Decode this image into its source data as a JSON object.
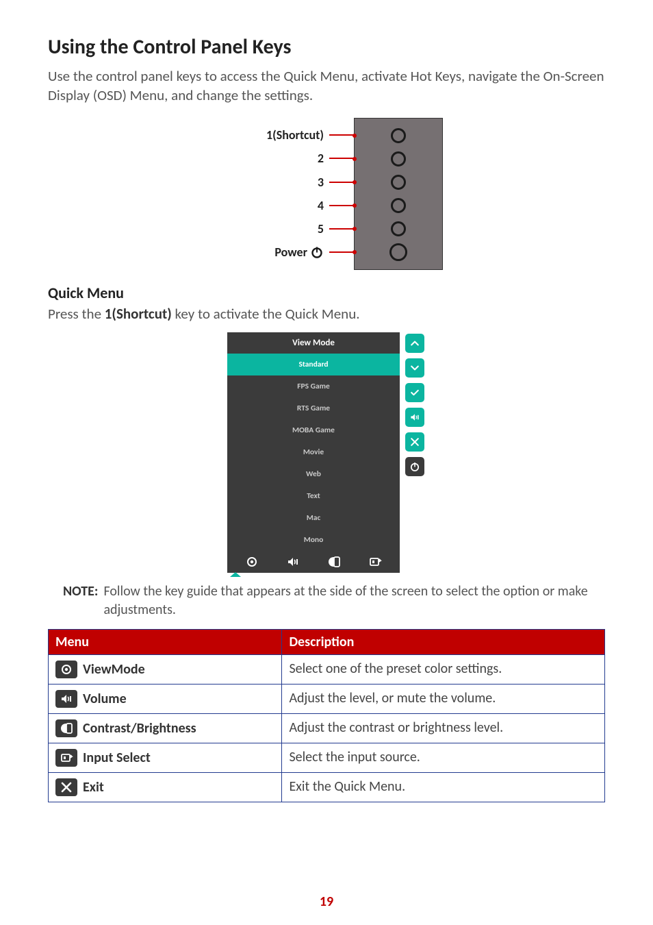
{
  "heading": "Using the Control Panel Keys",
  "intro": "Use the control panel keys to access the Quick Menu, activate Hot Keys, navigate the On-Screen Display (OSD) Menu, and change the settings.",
  "panel_labels": [
    "1(Shortcut)",
    "2",
    "3",
    "4",
    "5",
    "Power"
  ],
  "quick_menu_heading": "Quick Menu",
  "quick_menu_text_pre": "Press the ",
  "quick_menu_text_bold": "1(Shortcut)",
  "quick_menu_text_post": " key to activate the Quick Menu.",
  "osd": {
    "header": "View Mode",
    "items": [
      "Standard",
      "FPS Game",
      "RTS Game",
      "MOBA Game",
      "Movie",
      "Web",
      "Text",
      "Mac",
      "Mono"
    ],
    "selected_index": 0,
    "footer_icons": [
      "eye-icon",
      "volume-icon",
      "contrast-icon",
      "input-icon"
    ],
    "side_buttons": [
      "up-icon",
      "down-icon",
      "check-icon",
      "volume-icon",
      "close-icon",
      "power-icon"
    ]
  },
  "note_label": "NOTE:",
  "note_text": "Follow the key guide that appears at the side of the screen to select the option or make adjustments.",
  "table": {
    "headers": [
      "Menu",
      "Description"
    ],
    "rows": [
      {
        "icon": "eye-icon",
        "label": "ViewMode",
        "desc": "Select one of the preset color settings."
      },
      {
        "icon": "volume-icon",
        "label": "Volume",
        "desc": "Adjust the level, or mute the volume."
      },
      {
        "icon": "contrast-icon",
        "label": "Contrast/Brightness",
        "desc": "Adjust the contrast or brightness level."
      },
      {
        "icon": "input-icon",
        "label": "Input Select",
        "desc": "Select the input source."
      },
      {
        "icon": "close-icon",
        "label": "Exit",
        "desc": "Exit the Quick Menu."
      }
    ]
  },
  "page_number": "19"
}
